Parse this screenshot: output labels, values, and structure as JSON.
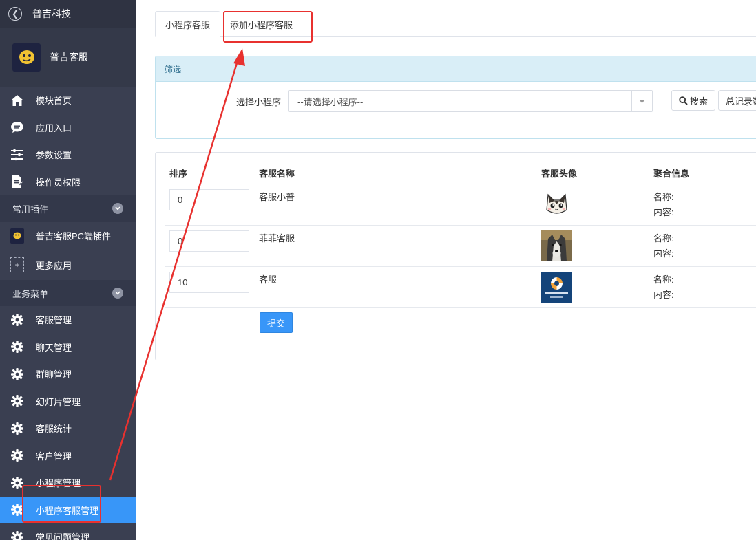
{
  "sidebar": {
    "top_title": "普吉科技",
    "brand_name": "普吉客服",
    "main_items": [
      {
        "label": "模块首页",
        "icon": "home-icon"
      },
      {
        "label": "应用入口",
        "icon": "chat-bubble-icon"
      },
      {
        "label": "参数设置",
        "icon": "list-settings-icon"
      },
      {
        "label": "操作员权限",
        "icon": "document-edit-icon"
      }
    ],
    "group_plugins": "常用插件",
    "plugin_items": [
      {
        "label": "普吉客服PC端插件",
        "icon": "plugin-logo-icon"
      },
      {
        "label": "更多应用",
        "icon": "plus-icon"
      }
    ],
    "group_business": "业务菜单",
    "business_items": [
      {
        "label": "客服管理",
        "icon": "gear-icon"
      },
      {
        "label": "聊天管理",
        "icon": "gear-icon"
      },
      {
        "label": "群聊管理",
        "icon": "gear-icon"
      },
      {
        "label": "幻灯片管理",
        "icon": "gear-icon"
      },
      {
        "label": "客服统计",
        "icon": "gear-icon"
      },
      {
        "label": "客户管理",
        "icon": "gear-icon"
      },
      {
        "label": "小程序管理",
        "icon": "gear-icon"
      },
      {
        "label": "小程序客服管理",
        "icon": "gear-icon",
        "active": true
      },
      {
        "label": "常见问题管理",
        "icon": "gear-icon"
      }
    ]
  },
  "tabs": [
    {
      "label": "小程序客服",
      "active": true
    },
    {
      "label": "添加小程序客服",
      "active": false
    }
  ],
  "filter": {
    "heading": "筛选",
    "label": "选择小程序",
    "select_value": "--请选择小程序--",
    "search_button": "搜索",
    "total_button": "总记录数"
  },
  "table": {
    "headers": [
      "排序",
      "客服名称",
      "客服头像",
      "聚合信息"
    ],
    "rows": [
      {
        "sort": "0",
        "name": "客服小普",
        "avatar": "cartoon-cat-avatar",
        "info_name": "名称:",
        "info_content": "内容:"
      },
      {
        "sort": "0",
        "name": "菲菲客服",
        "avatar": "husky-dog-avatar",
        "info_name": "名称:",
        "info_content": "内容:"
      },
      {
        "sort": "10",
        "name": "客服",
        "avatar": "pujikeji-logo-avatar",
        "info_name": "名称:",
        "info_content": "内容:"
      }
    ],
    "submit": "提交"
  },
  "colors": {
    "sidebar_bg": "#3a3f51",
    "active_blue": "#3896f8",
    "annotation_red": "#e8312f",
    "filter_header": "#d9eef7"
  }
}
